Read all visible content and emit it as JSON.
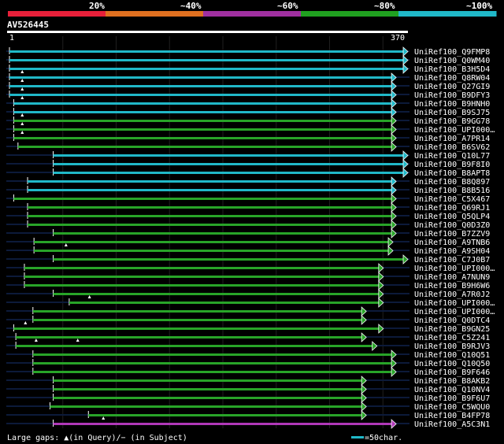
{
  "legend": {
    "colors": [
      "#e8203a",
      "#e07020",
      "#a030a0",
      "#20a020",
      "#20b8c8"
    ],
    "labels": [
      "20%",
      "~40%",
      "~60%",
      "~80%",
      "~100%"
    ]
  },
  "query": {
    "name": "AV526445",
    "start": "1",
    "end": "370"
  },
  "footer": {
    "gaps_text": "Large gaps: ▲(in Query)/− (in Subject)",
    "scale_text": "=50char."
  },
  "hits": [
    {
      "name": "UniRef100_Q9FMP8",
      "color": "cyan",
      "qs": 1,
      "qe": 370,
      "ticks": []
    },
    {
      "name": "UniRef100_Q0WM40",
      "color": "cyan",
      "qs": 1,
      "qe": 370,
      "ticks": []
    },
    {
      "name": "UniRef100_B3H5D4",
      "color": "cyan",
      "qs": 1,
      "qe": 370,
      "ticks": []
    },
    {
      "name": "UniRef100_Q8RW04",
      "color": "cyan",
      "qs": 1,
      "qe": 359,
      "ticks": [
        13
      ]
    },
    {
      "name": "UniRef100_Q27GI9",
      "color": "cyan",
      "qs": 1,
      "qe": 359,
      "ticks": [
        13
      ]
    },
    {
      "name": "UniRef100_B9DFY3",
      "color": "cyan",
      "qs": 1,
      "qe": 359,
      "ticks": [
        13
      ]
    },
    {
      "name": "UniRef100_B9HNH0",
      "color": "cyan",
      "qs": 5,
      "qe": 359,
      "ticks": [
        13
      ]
    },
    {
      "name": "UniRef100_B9SJ75",
      "color": "cyan",
      "qs": 5,
      "qe": 359,
      "ticks": []
    },
    {
      "name": "UniRef100_B9GG78",
      "color": "green",
      "qs": 5,
      "qe": 359,
      "ticks": [
        13
      ]
    },
    {
      "name": "UniRef100_UPI000…",
      "color": "green",
      "qs": 5,
      "qe": 359,
      "ticks": [
        13
      ]
    },
    {
      "name": "UniRef100_A7PR14",
      "color": "green",
      "qs": 5,
      "qe": 359,
      "ticks": [
        13
      ]
    },
    {
      "name": "UniRef100_B6SV62",
      "color": "green",
      "qs": 9,
      "qe": 359,
      "ticks": []
    },
    {
      "name": "UniRef100_Q10L77",
      "color": "cyan",
      "qs": 42,
      "qe": 370,
      "ticks": []
    },
    {
      "name": "UniRef100_B9F8I0",
      "color": "cyan",
      "qs": 42,
      "qe": 370,
      "ticks": []
    },
    {
      "name": "UniRef100_B8APT8",
      "color": "cyan",
      "qs": 42,
      "qe": 370,
      "ticks": []
    },
    {
      "name": "UniRef100_B8Q897",
      "color": "cyan",
      "qs": 18,
      "qe": 359,
      "ticks": []
    },
    {
      "name": "UniRef100_B8B516",
      "color": "cyan",
      "qs": 18,
      "qe": 359,
      "ticks": []
    },
    {
      "name": "UniRef100_C5X467",
      "color": "green",
      "qs": 5,
      "qe": 359,
      "ticks": []
    },
    {
      "name": "UniRef100_Q69RJ1",
      "color": "green",
      "qs": 18,
      "qe": 359,
      "ticks": []
    },
    {
      "name": "UniRef100_Q5QLP4",
      "color": "green",
      "qs": 18,
      "qe": 359,
      "ticks": []
    },
    {
      "name": "UniRef100_Q0D3Z0",
      "color": "green",
      "qs": 18,
      "qe": 359,
      "ticks": []
    },
    {
      "name": "UniRef100_B7ZZV9",
      "color": "green",
      "qs": 42,
      "qe": 359,
      "ticks": []
    },
    {
      "name": "UniRef100_A9TNB6",
      "color": "green",
      "qs": 24,
      "qe": 356,
      "ticks": []
    },
    {
      "name": "UniRef100_A9SH04",
      "color": "green",
      "qs": 24,
      "qe": 356,
      "ticks": [
        54
      ]
    },
    {
      "name": "UniRef100_C7J0B7",
      "color": "green",
      "qs": 42,
      "qe": 370,
      "ticks": []
    },
    {
      "name": "UniRef100_UPI000…",
      "color": "green",
      "qs": 15,
      "qe": 347,
      "ticks": []
    },
    {
      "name": "UniRef100_A7NUN9",
      "color": "green",
      "qs": 15,
      "qe": 347,
      "ticks": []
    },
    {
      "name": "UniRef100_B9H6W6",
      "color": "green",
      "qs": 15,
      "qe": 347,
      "ticks": []
    },
    {
      "name": "UniRef100_A7R0J2",
      "color": "green",
      "qs": 42,
      "qe": 347,
      "ticks": []
    },
    {
      "name": "UniRef100_UPI000…",
      "color": "green",
      "qs": 57,
      "qe": 347,
      "ticks": [
        76
      ]
    },
    {
      "name": "UniRef100_UPI000…",
      "color": "green",
      "qs": 23,
      "qe": 331,
      "ticks": []
    },
    {
      "name": "UniRef100_Q0DTC4",
      "color": "green",
      "qs": 23,
      "qe": 331,
      "ticks": []
    },
    {
      "name": "UniRef100_B9GN25",
      "color": "green",
      "qs": 5,
      "qe": 347,
      "ticks": [
        16
      ]
    },
    {
      "name": "UniRef100_C5Z241",
      "color": "green",
      "qs": 7,
      "qe": 331,
      "ticks": []
    },
    {
      "name": "UniRef100_B9RJV3",
      "color": "green",
      "qs": 7,
      "qe": 341,
      "ticks": [
        26,
        65
      ]
    },
    {
      "name": "UniRef100_Q10Q51",
      "color": "green",
      "qs": 23,
      "qe": 359,
      "ticks": []
    },
    {
      "name": "UniRef100_Q10Q50",
      "color": "green",
      "qs": 23,
      "qe": 359,
      "ticks": []
    },
    {
      "name": "UniRef100_B9F646",
      "color": "green",
      "qs": 23,
      "qe": 359,
      "ticks": []
    },
    {
      "name": "UniRef100_B8AKB2",
      "color": "green",
      "qs": 42,
      "qe": 331,
      "ticks": []
    },
    {
      "name": "UniRef100_Q10NV4",
      "color": "green",
      "qs": 42,
      "qe": 331,
      "ticks": []
    },
    {
      "name": "UniRef100_B9F6U7",
      "color": "green",
      "qs": 42,
      "qe": 331,
      "ticks": []
    },
    {
      "name": "UniRef100_C5WQU0",
      "color": "green",
      "qs": 39,
      "qe": 331,
      "ticks": []
    },
    {
      "name": "UniRef100_B4FP78",
      "color": "green",
      "qs": 75,
      "qe": 331,
      "ticks": []
    },
    {
      "name": "UniRef100_A5C3N1",
      "color": "magenta",
      "qs": 42,
      "qe": 359,
      "ticks": [
        89
      ]
    }
  ]
}
